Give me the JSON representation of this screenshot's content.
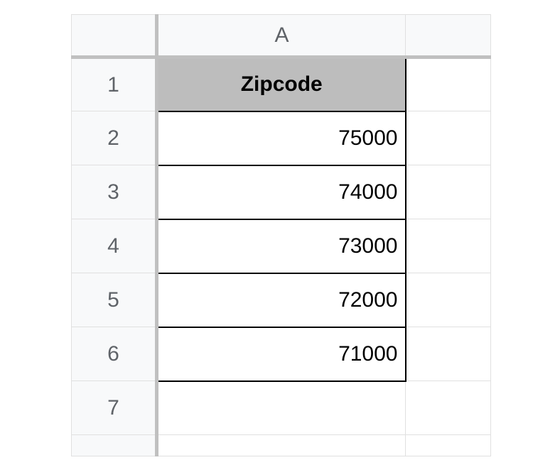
{
  "columns": {
    "A": "A"
  },
  "rows": {
    "r1": "1",
    "r2": "2",
    "r3": "3",
    "r4": "4",
    "r5": "5",
    "r6": "6",
    "r7": "7"
  },
  "cells": {
    "A1": "Zipcode",
    "A2": "75000",
    "A3": "74000",
    "A4": "73000",
    "A5": "72000",
    "A6": "71000"
  }
}
